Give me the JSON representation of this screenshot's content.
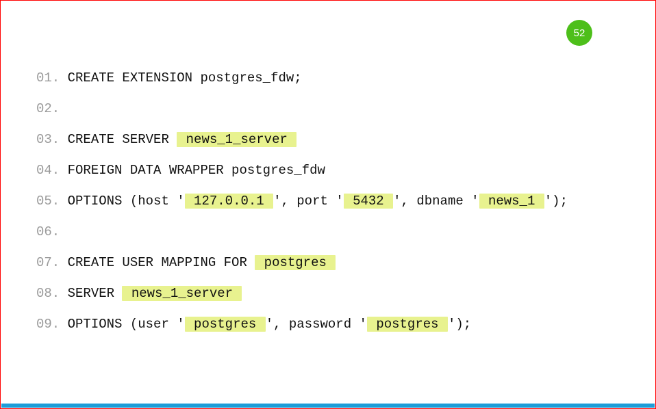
{
  "badge": "52",
  "code": {
    "lines": [
      {
        "num": "01.",
        "segments": [
          {
            "t": " CREATE EXTENSION postgres_fdw;",
            "hl": false
          }
        ]
      },
      {
        "num": "02.",
        "segments": []
      },
      {
        "num": "03.",
        "segments": [
          {
            "t": " CREATE SERVER ",
            "hl": false
          },
          {
            "t": " news_1_server ",
            "hl": true
          }
        ]
      },
      {
        "num": "04.",
        "segments": [
          {
            "t": " FOREIGN DATA WRAPPER postgres_fdw",
            "hl": false
          }
        ]
      },
      {
        "num": "05.",
        "segments": [
          {
            "t": " OPTIONS (host '",
            "hl": false
          },
          {
            "t": " 127.0.0.1 ",
            "hl": true
          },
          {
            "t": "', port '",
            "hl": false
          },
          {
            "t": " 5432 ",
            "hl": true
          },
          {
            "t": "', dbname '",
            "hl": false
          },
          {
            "t": " news_1 ",
            "hl": true
          },
          {
            "t": "');",
            "hl": false
          }
        ]
      },
      {
        "num": "06.",
        "segments": []
      },
      {
        "num": "07.",
        "segments": [
          {
            "t": " CREATE USER MAPPING FOR ",
            "hl": false
          },
          {
            "t": " postgres ",
            "hl": true
          }
        ]
      },
      {
        "num": "08.",
        "segments": [
          {
            "t": " SERVER ",
            "hl": false
          },
          {
            "t": " news_1_server ",
            "hl": true
          }
        ]
      },
      {
        "num": "09.",
        "segments": [
          {
            "t": " OPTIONS (user '",
            "hl": false
          },
          {
            "t": " postgres ",
            "hl": true
          },
          {
            "t": "', password '",
            "hl": false
          },
          {
            "t": " postgres ",
            "hl": true
          },
          {
            "t": "');",
            "hl": false
          }
        ]
      }
    ]
  }
}
